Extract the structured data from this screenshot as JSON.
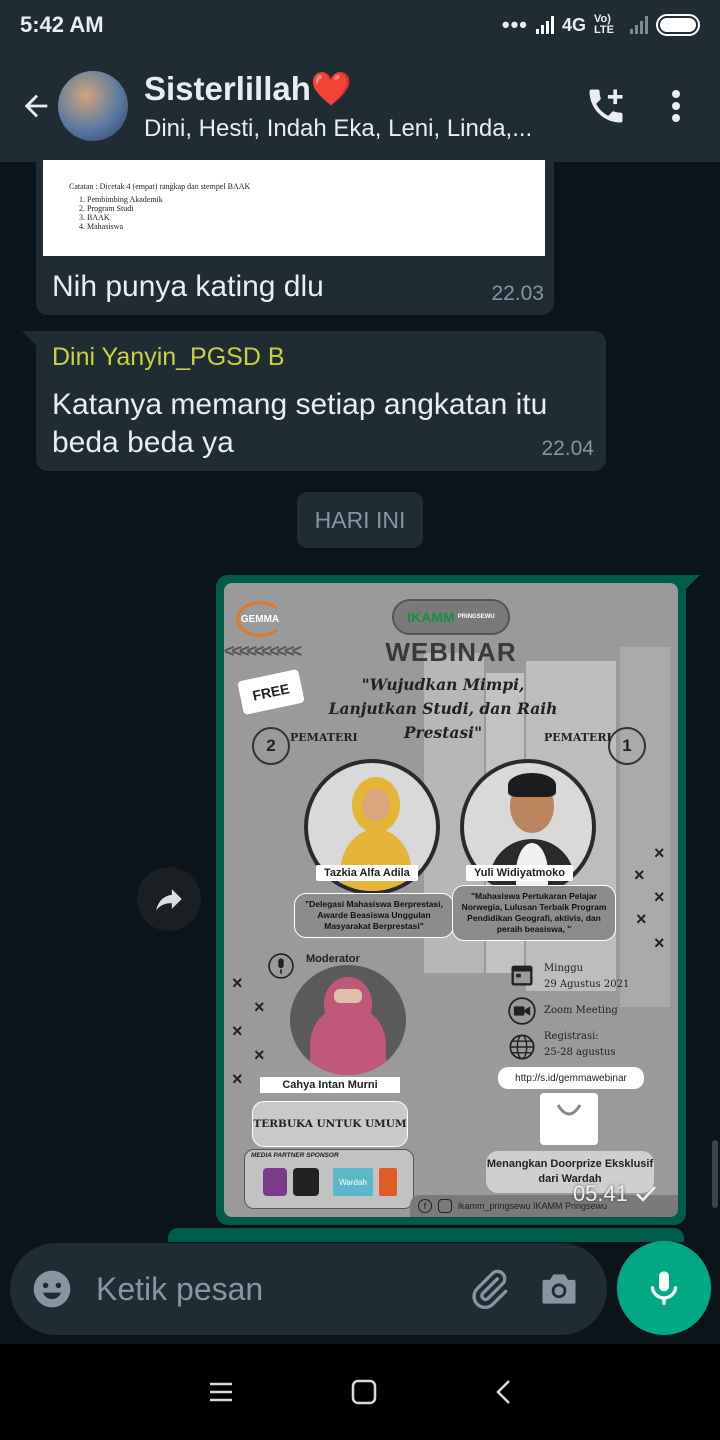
{
  "status_bar": {
    "time": "5:42 AM",
    "network": "4G",
    "volte": "Vo) LTE"
  },
  "chat_header": {
    "name": "Sisterlillah❤️",
    "members": "Dini, Hesti, Indah Eka, Leni, Linda,..."
  },
  "messages": [
    {
      "type": "image_with_caption",
      "doc_thumbnail": {
        "heading": "Catatan : Dicetak 4 (empat) rangkap dan stempel BAAK",
        "items": [
          "Pembimbing Akademik",
          "Program Studi",
          "BAAK",
          "Mahasiswa"
        ]
      },
      "text": "Nih punya kating dlu",
      "time": "22.03"
    },
    {
      "type": "text",
      "sender": "Dini Yanyin_PGSD B",
      "text": "Katanya memang setiap angkatan itu beda beda ya",
      "time": "22.04"
    }
  ],
  "day_separator": "HARI INI",
  "poster_message": {
    "time": "05.41",
    "poster": {
      "gemma": "GEMMA",
      "ikamm": "IKAMM",
      "ikamm_sub": "PRINGSEWU",
      "title": "WEBINAR",
      "free": "FREE",
      "tagline": "\"Wujudkan Mimpi, Lanjutkan Studi, dan Raih Prestasi\"",
      "pemateri_label": "PEMATERI",
      "speaker_left": {
        "number": "2",
        "name": "Tazkia Alfa Adila",
        "desc": "\"Delegasi Mahasiswa Berprestasi, Awarde Beasiswa Unggulan Masyarakat Berprestasi\""
      },
      "speaker_right": {
        "number": "1",
        "name": "Yuli Widiyatmoko",
        "desc": "\"Mahasiswa Pertukaran Pelajar Norwegia, Lulusan Terbaik Program Pendidikan Geografi, aktivis, dan peraih beasiswa, \""
      },
      "moderator_label": "Moderator",
      "moderator_name": "Cahya Intan Murni",
      "open_label": "TERBUKA UNTUK UMUM",
      "sponsor_header": "MEDIA PARTNER    SPONSOR",
      "sponsor_brand": "Wardah",
      "day": "Minggu",
      "date": "29 Agustus 2021",
      "platform": "Zoom Meeting",
      "reg_label": "Registrasi:",
      "reg_dates": "25-28 agustus",
      "url": "http://s.id/gemmawebinar",
      "doorprize": "Menangkan Doorprize Eksklusif dari Wardah",
      "social": "ikamm_pringsewu   IKAMM Pringsewu"
    }
  },
  "composer": {
    "placeholder": "Ketik pesan"
  },
  "colors": {
    "header_bg": "#1f2c34",
    "chat_bg": "#0b141a",
    "outgoing_bubble": "#005c4b",
    "sender_name": "#c7d23c",
    "mic_button": "#00a884"
  }
}
